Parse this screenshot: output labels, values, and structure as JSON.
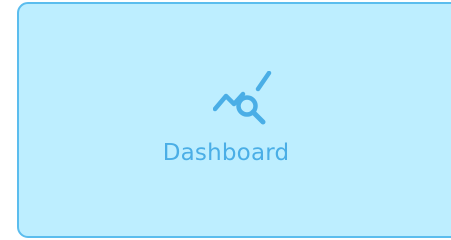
{
  "tile": {
    "label": "Dashboard",
    "icon": "chart-search-icon",
    "background_color": "#bdeeff",
    "border_color": "#5bbdee",
    "accent_color": "#4aaee6"
  }
}
